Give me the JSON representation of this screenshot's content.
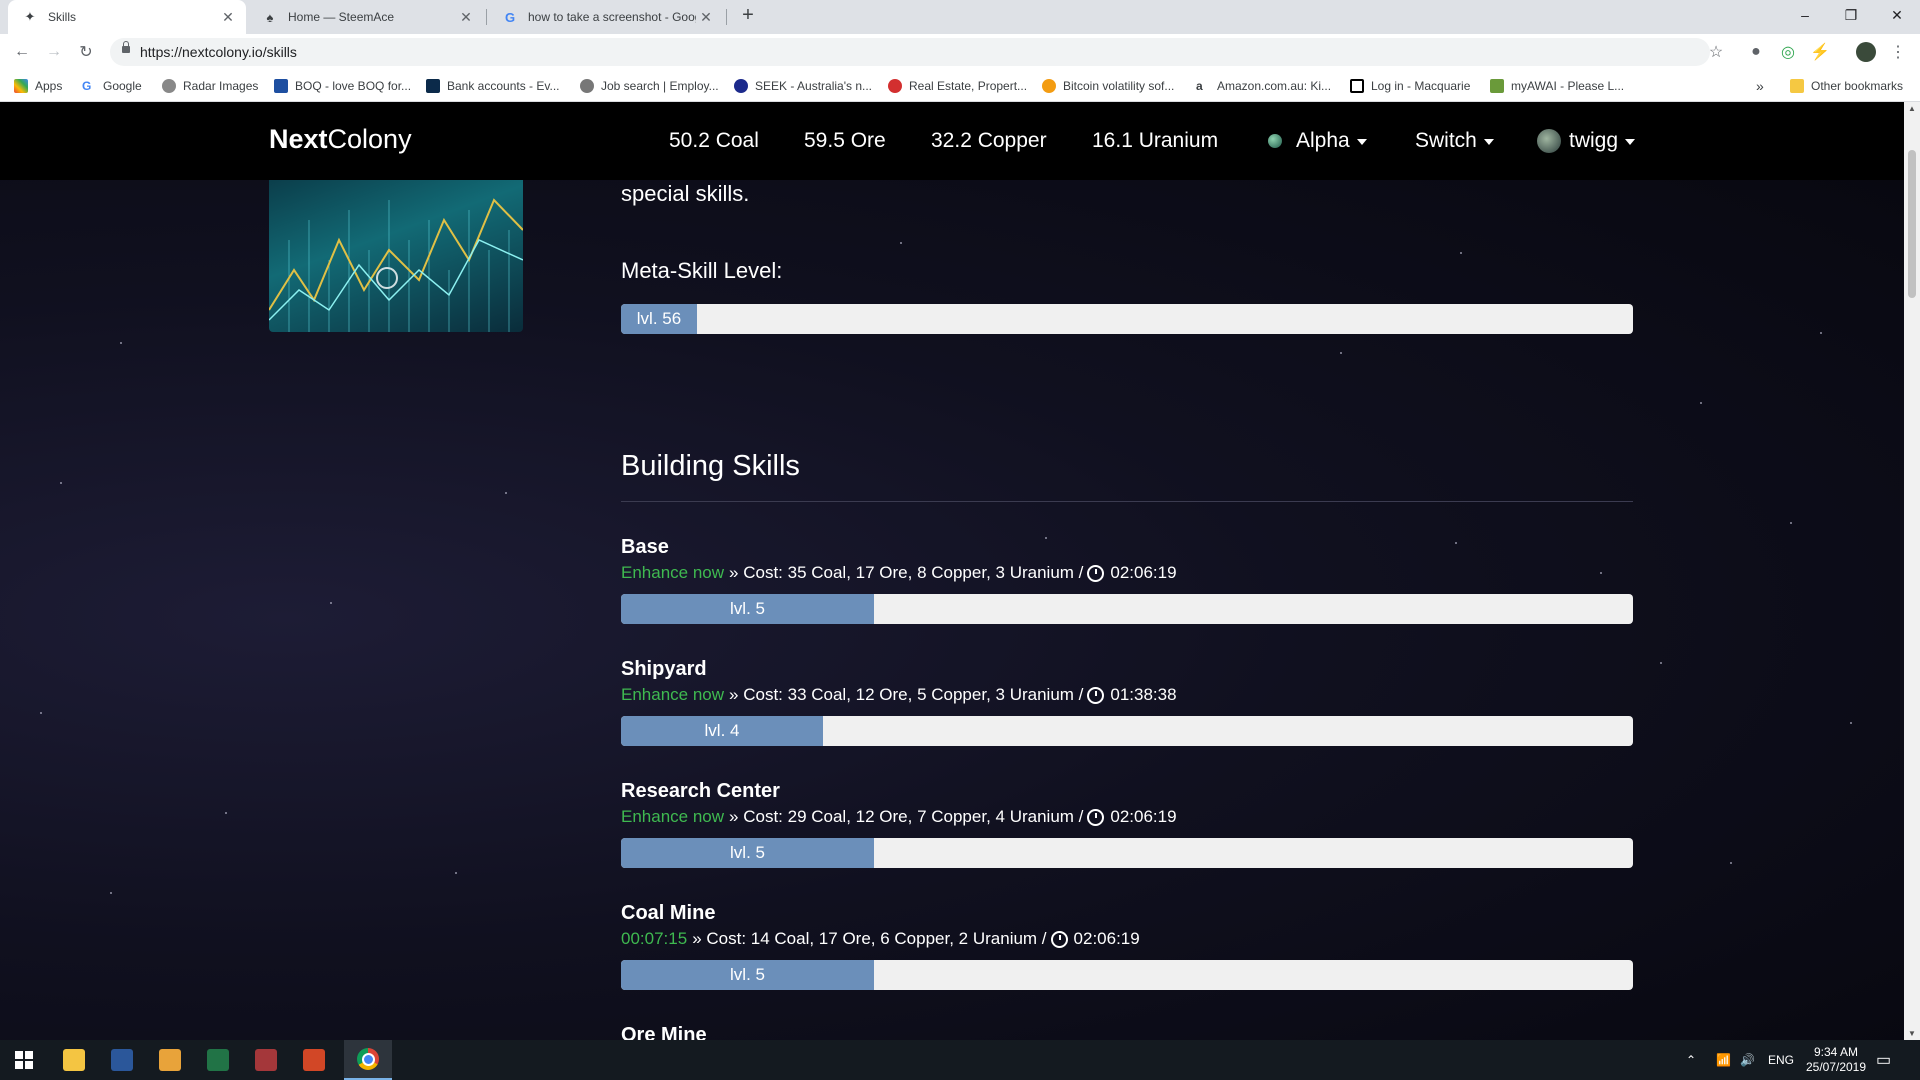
{
  "browser": {
    "tabs": [
      {
        "title": "Skills",
        "active": true
      },
      {
        "title": "Home — SteemAce",
        "active": false
      },
      {
        "title": "how to take a screenshot - Goog",
        "active": false
      }
    ],
    "new_tab": "+",
    "url": "https://nextcolony.io/skills",
    "bookmarks": [
      {
        "label": "Apps"
      },
      {
        "label": "Google"
      },
      {
        "label": "Radar Images"
      },
      {
        "label": "BOQ - love BOQ for..."
      },
      {
        "label": "Bank accounts - Ev..."
      },
      {
        "label": "Job search | Employ..."
      },
      {
        "label": "SEEK - Australia's n..."
      },
      {
        "label": "Real Estate, Propert..."
      },
      {
        "label": "Bitcoin volatility sof..."
      },
      {
        "label": "Amazon.com.au: Ki..."
      },
      {
        "label": "Log in - Macquarie"
      },
      {
        "label": "myAWAI - Please L..."
      }
    ],
    "more_bookmarks": "»",
    "other_bookmarks": "Other bookmarks"
  },
  "nav": {
    "brand_bold": "Next",
    "brand_rest": "Colony",
    "resources": [
      "50.2 Coal",
      "59.5 Ore",
      "32.2 Copper",
      "16.1 Uranium"
    ],
    "planet": "Alpha",
    "switch": "Switch",
    "user": "twigg"
  },
  "intro": {
    "text_fragment": "special skills.",
    "meta_label": "Meta-Skill Level:",
    "meta_level_text": "lvl. 56",
    "meta_level_progress": 0.075
  },
  "building_skills": {
    "title": "Building Skills",
    "items": [
      {
        "name": "Base",
        "action": "Enhance now",
        "cost": "» Cost: 35 Coal, 17 Ore, 8 Copper, 3 Uranium /",
        "time": "02:06:19",
        "level_text": "lvl. 5",
        "progress": 0.25
      },
      {
        "name": "Shipyard",
        "action": "Enhance now",
        "cost": "» Cost: 33 Coal, 12 Ore, 5 Copper, 3 Uranium /",
        "time": "01:38:38",
        "level_text": "lvl. 4",
        "progress": 0.2
      },
      {
        "name": "Research Center",
        "action": "Enhance now",
        "cost": "» Cost: 29 Coal, 12 Ore, 7 Copper, 4 Uranium /",
        "time": "02:06:19",
        "level_text": "lvl. 5",
        "progress": 0.25
      },
      {
        "name": "Coal Mine",
        "action": "00:07:15",
        "cost": "» Cost: 14 Coal, 17 Ore, 6 Copper, 2 Uranium /",
        "time": "02:06:19",
        "level_text": "lvl. 5",
        "progress": 0.25
      },
      {
        "name": "Ore Mine"
      }
    ]
  },
  "taskbar": {
    "language": "ENG",
    "time": "9:34 AM",
    "date": "25/07/2019"
  },
  "colors": {
    "accent_green": "#3fb950",
    "progress_fill": "#6b8fba",
    "navbar_bg": "#000000"
  }
}
